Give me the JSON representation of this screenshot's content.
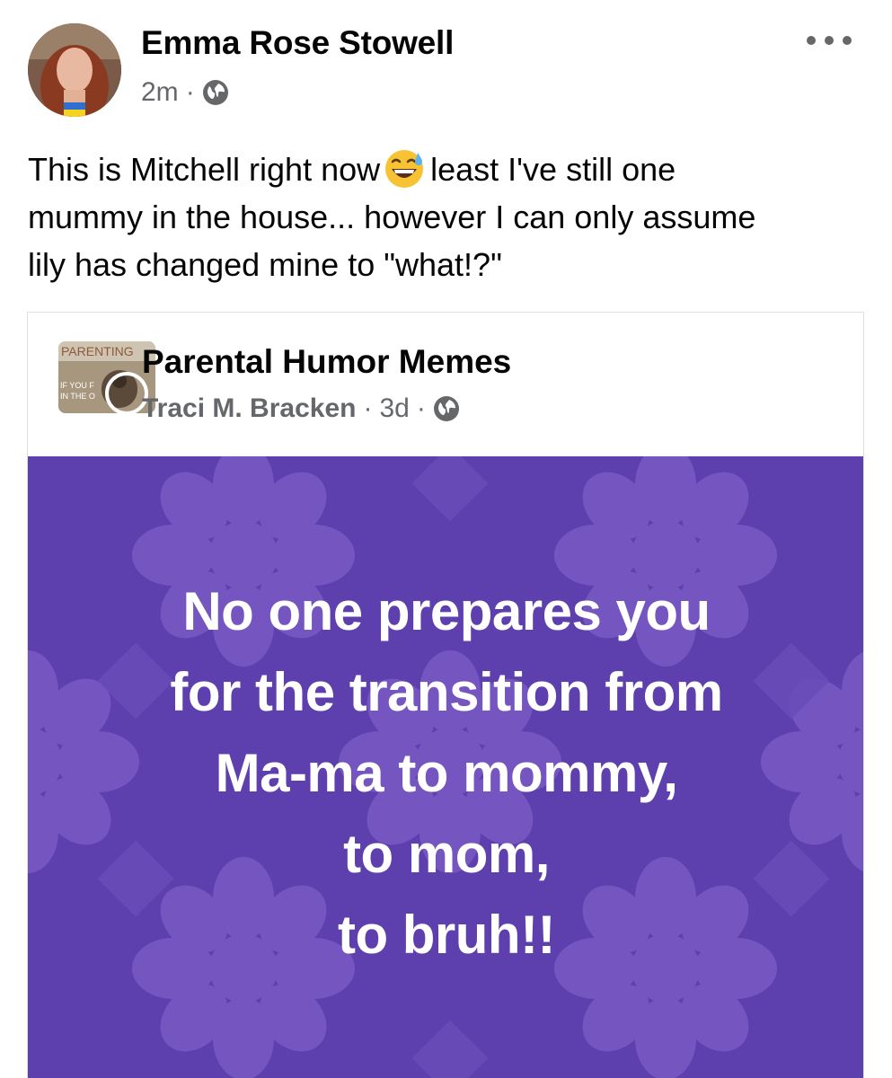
{
  "post": {
    "author": "Emma Rose Stowell",
    "time": "2m",
    "separator": "·",
    "privacy_icon": "globe-icon",
    "text_lines": [
      "This is Mitchell right now",
      "least I've still one",
      "mummy in the house... however I can only assume",
      "lily has changed mine to \"what!?\""
    ],
    "emoji": "grinning-face-with-sweat"
  },
  "shared": {
    "group_name": "Parental Humor Memes",
    "group_avatar_text": [
      "PARENTING",
      "IF YOU F",
      "IN THE O"
    ],
    "poster": "Traci M. Bracken",
    "time": "3d",
    "separator": "·",
    "meme_lines": [
      "No one prepares you",
      "for the transition from",
      "Ma-ma to mommy,",
      "to mom,",
      "to bruh!!"
    ],
    "meme_bg_color": "#5e3fae"
  }
}
